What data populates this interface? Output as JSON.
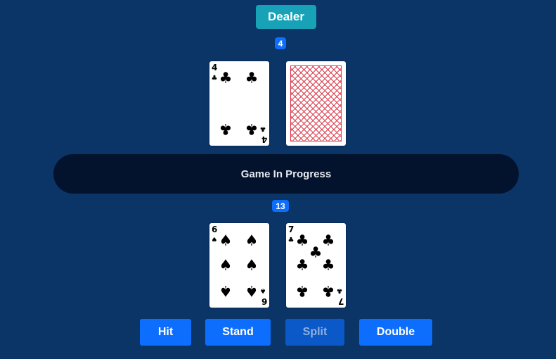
{
  "dealer": {
    "label": "Dealer",
    "score": "4",
    "cards": [
      {
        "rank": "4",
        "suit": "♣",
        "face_up": true
      },
      {
        "face_up": false,
        "back_pattern": "red-lattice-icon"
      }
    ]
  },
  "status": {
    "text": "Game In Progress"
  },
  "player": {
    "score": "13",
    "cards": [
      {
        "rank": "6",
        "suit": "♠",
        "face_up": true
      },
      {
        "rank": "7",
        "suit": "♣",
        "face_up": true
      }
    ]
  },
  "actions": {
    "hit": "Hit",
    "stand": "Stand",
    "split": "Split",
    "split_enabled": false,
    "double": "Double"
  },
  "colors": {
    "background": "#0b3467",
    "dealer_button": "#17a2b8",
    "primary": "#0d6efd",
    "status_bar": "#03132e",
    "card_back": "#d8394a"
  }
}
